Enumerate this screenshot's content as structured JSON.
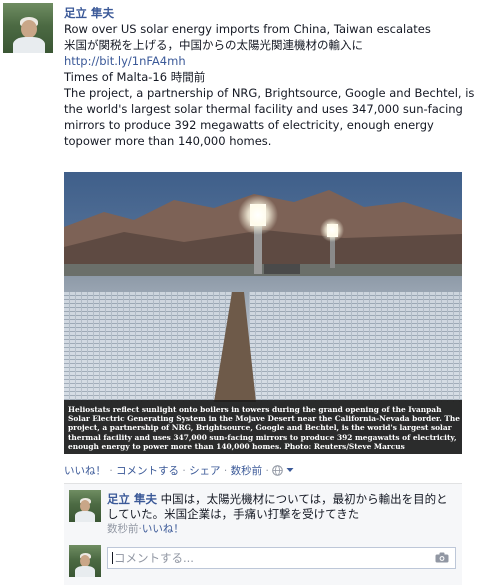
{
  "post": {
    "author": "足立 隼夫",
    "line1": "Row over US solar energy imports from China, Taiwan escalates",
    "line2": "米国が関税を上げる，中国からの太陽光関連機材の輸入に",
    "link": "http://bit.ly/1nFA4mh",
    "source": "Times of Malta-16 時間前",
    "body": "The project, a partnership of NRG, Brightsource, Google and Bechtel, is the world's largest solar thermal facility and uses 347,000 sun-facing mirrors to produce 392 megawatts of electricity, enough energy topower more than 140,000 homes."
  },
  "photo": {
    "caption": "Heliostats reflect sunlight onto boilers in towers during the grand opening of the Ivanpah Solar Electric Generating System in the Mojave Desert near the California-Nevada border. The project, a partnership of NRG, Brightsource, Google and Bechtel, is the world's largest solar thermal facility and uses 347,000 sun-facing mirrors to produce 392 megawatts of electricity, enough energy to power more than 140,000 homes. Photo: Reuters/Steve Marcus"
  },
  "actions": {
    "like": "いいね！",
    "comment": "コメントする",
    "share": "シェア",
    "time": "数秒前",
    "separator": "·",
    "privacy_icon": "globe-icon",
    "dropdown_icon": "chevron-down-icon"
  },
  "comment": {
    "author": "足立 隼夫",
    "text": "中国は，太陽光機材については，最初から輸出を目的としていた。米国企業は，手痛い打撃を受けてきた",
    "time": "数秒前",
    "like": "いいね！"
  },
  "comment_input": {
    "placeholder": "コメントする...",
    "camera_icon": "camera-icon"
  },
  "colors": {
    "link": "#3b5998",
    "meta": "#9197a3",
    "comment_bg": "#f6f7f9"
  }
}
